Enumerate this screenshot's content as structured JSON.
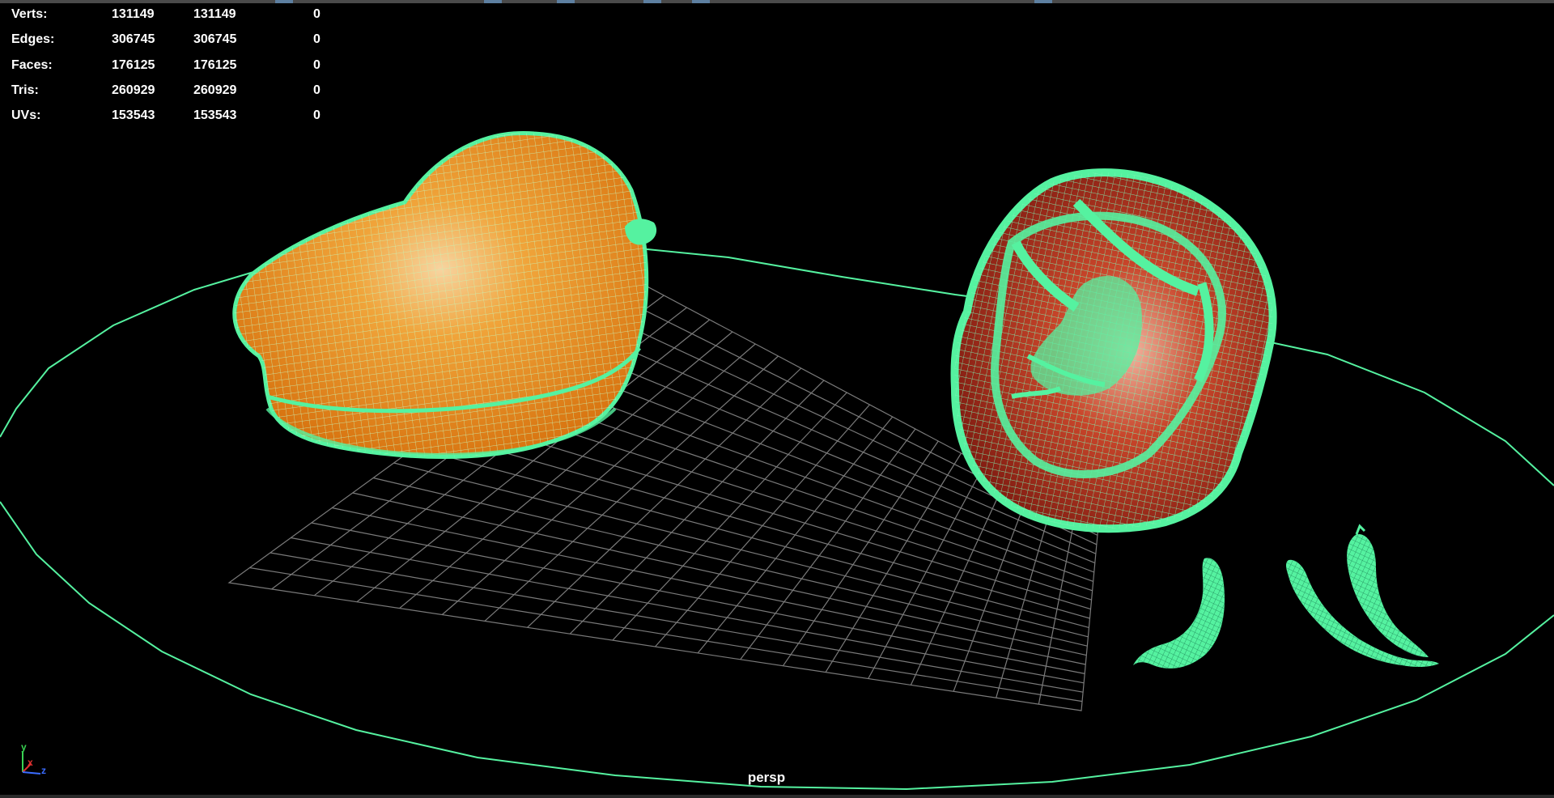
{
  "viewport": {
    "camera_name": "persp",
    "background_color": "#000000",
    "wireframe_color": "#55f2a0",
    "grid_color": "#7a7a7a"
  },
  "hud": {
    "rows": [
      {
        "label": "Verts:",
        "v1": "131149",
        "v2": "131149",
        "v3": "0"
      },
      {
        "label": "Edges:",
        "v1": "306745",
        "v2": "306745",
        "v3": "0"
      },
      {
        "label": "Faces:",
        "v1": "176125",
        "v2": "176125",
        "v3": "0"
      },
      {
        "label": "Tris:",
        "v1": "260929",
        "v2": "260929",
        "v3": "0"
      },
      {
        "label": "UVs:",
        "v1": "153543",
        "v2": "153543",
        "v3": "0"
      }
    ]
  },
  "axis": {
    "y_label": "y",
    "x_label": "x",
    "z_label": "z",
    "y_color": "#39d353",
    "x_color": "#e03030",
    "z_color": "#3a6cff"
  },
  "objects": [
    {
      "name": "bell-pepper-whole",
      "color": "#e8911a"
    },
    {
      "name": "bell-pepper-half",
      "color": "#b5321f"
    },
    {
      "name": "chili-pepper"
    },
    {
      "name": "chili-pepper-pair"
    },
    {
      "name": "plate-outline"
    },
    {
      "name": "ground-grid"
    }
  ]
}
